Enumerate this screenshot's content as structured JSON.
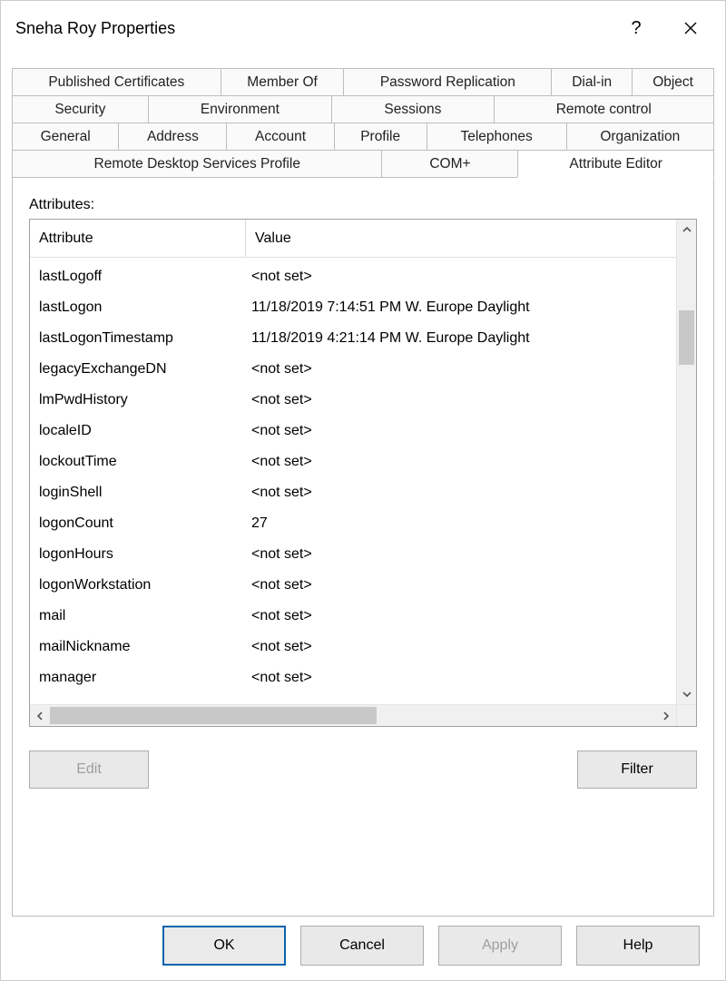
{
  "window_title": "Sneha Roy Properties",
  "tabs": {
    "row1": [
      "Published Certificates",
      "Member Of",
      "Password Replication",
      "Dial-in",
      "Object"
    ],
    "row2": [
      "Security",
      "Environment",
      "Sessions",
      "Remote control"
    ],
    "row3": [
      "General",
      "Address",
      "Account",
      "Profile",
      "Telephones",
      "Organization"
    ],
    "row4": [
      "Remote Desktop Services Profile",
      "COM+",
      "Attribute Editor"
    ]
  },
  "active_tab": "Attribute Editor",
  "attributes_label": "Attributes:",
  "columns": {
    "attribute": "Attribute",
    "value": "Value"
  },
  "rows": [
    {
      "attr": "lastLogoff",
      "val": "<not set>"
    },
    {
      "attr": "lastLogon",
      "val": "11/18/2019 7:14:51 PM W. Europe Daylight"
    },
    {
      "attr": "lastLogonTimestamp",
      "val": "11/18/2019 4:21:14 PM W. Europe Daylight"
    },
    {
      "attr": "legacyExchangeDN",
      "val": "<not set>"
    },
    {
      "attr": "lmPwdHistory",
      "val": "<not set>"
    },
    {
      "attr": "localeID",
      "val": "<not set>"
    },
    {
      "attr": "lockoutTime",
      "val": "<not set>"
    },
    {
      "attr": "loginShell",
      "val": "<not set>"
    },
    {
      "attr": "logonCount",
      "val": "27"
    },
    {
      "attr": "logonHours",
      "val": "<not set>"
    },
    {
      "attr": "logonWorkstation",
      "val": "<not set>"
    },
    {
      "attr": "mail",
      "val": "<not set>"
    },
    {
      "attr": "mailNickname",
      "val": "<not set>"
    },
    {
      "attr": "manager",
      "val": "<not set>"
    }
  ],
  "buttons": {
    "edit": "Edit",
    "filter": "Filter",
    "ok": "OK",
    "cancel": "Cancel",
    "apply": "Apply",
    "help": "Help"
  }
}
